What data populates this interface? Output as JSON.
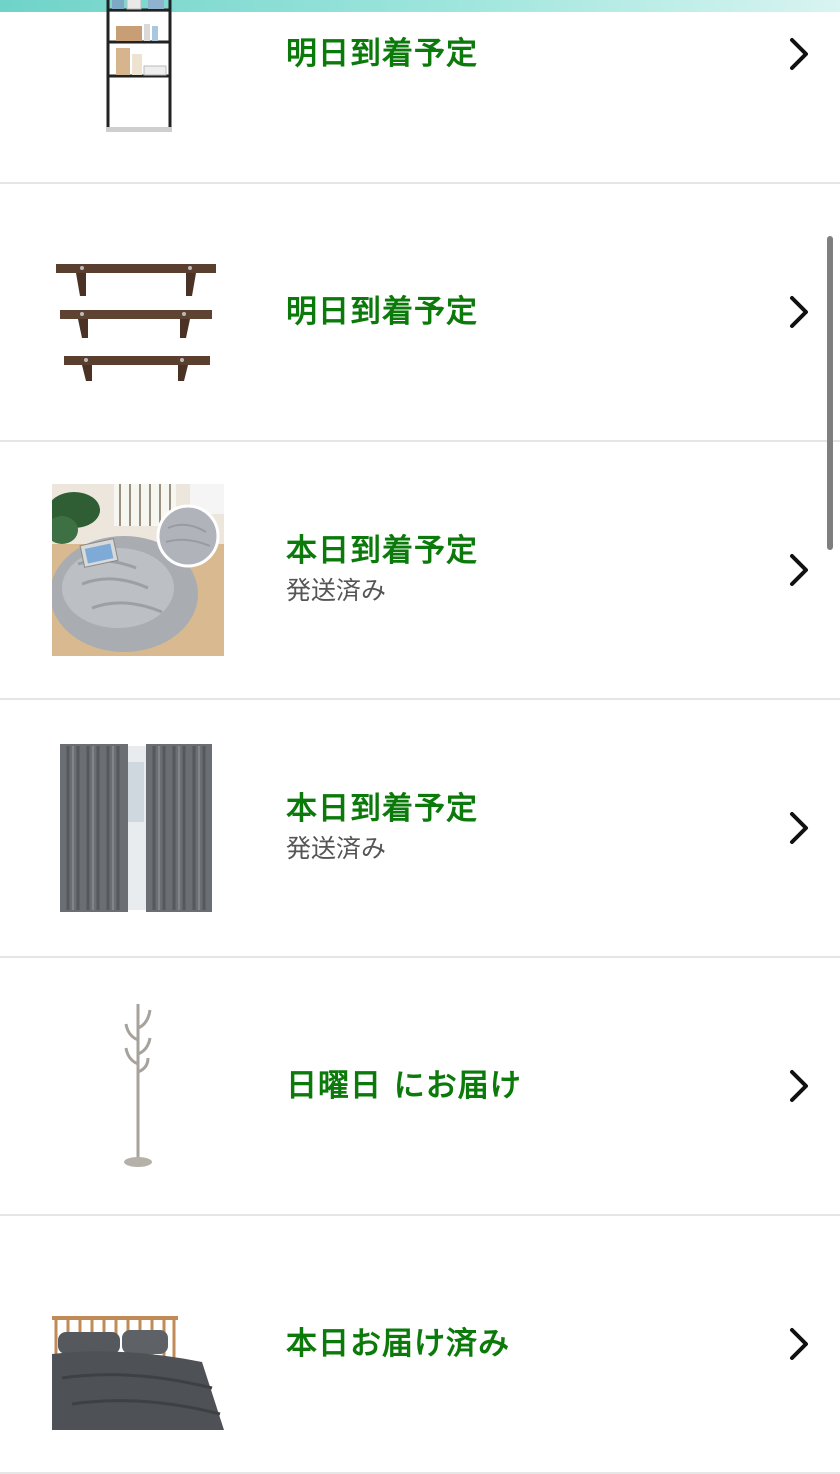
{
  "orders": [
    {
      "status": "明日到着予定",
      "sub": "",
      "image": "ladder-shelf-image"
    },
    {
      "status": "明日到着予定",
      "sub": "",
      "image": "wall-shelves-image"
    },
    {
      "status": "本日到着予定",
      "sub": "発送済み",
      "image": "fluffy-rug-image"
    },
    {
      "status": "本日到着予定",
      "sub": "発送済み",
      "image": "gray-curtains-image"
    },
    {
      "status": "日曜日 にお届け",
      "sub": "",
      "image": "coat-rack-image"
    },
    {
      "status": "本日お届け済み",
      "sub": "",
      "image": "bed-image"
    }
  ],
  "icons": {
    "row_action": "chevron-right-icon"
  },
  "colors": {
    "status_green": "#0b7a0b",
    "sub_text": "#555555",
    "divider": "#e6e6e6"
  }
}
